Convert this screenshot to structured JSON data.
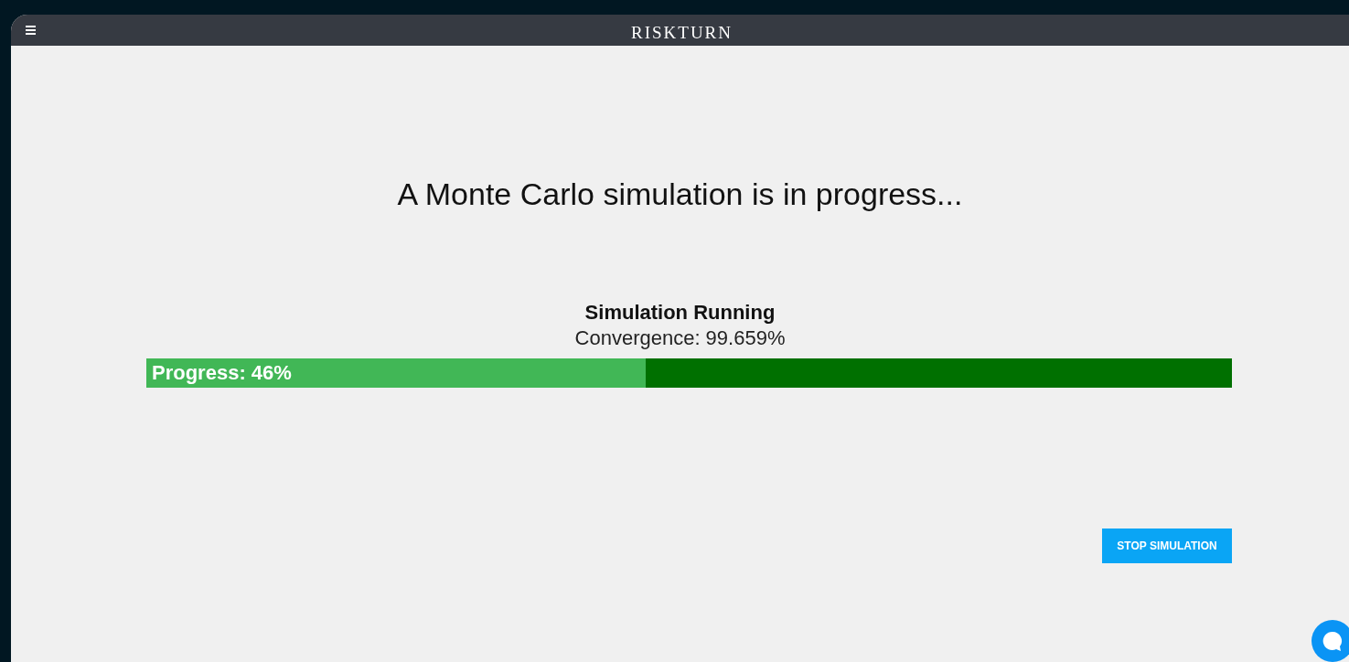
{
  "header": {
    "logo": "RISKTURN"
  },
  "heading": "A Monte Carlo simulation is in progress...",
  "status": {
    "title": "Simulation Running",
    "convergence": "Convergence: 99.659%"
  },
  "progress": {
    "label": "Progress: 46%",
    "level": 0.46
  },
  "buttons": [
    {
      "label": "STOP SIMULATION"
    }
  ]
}
